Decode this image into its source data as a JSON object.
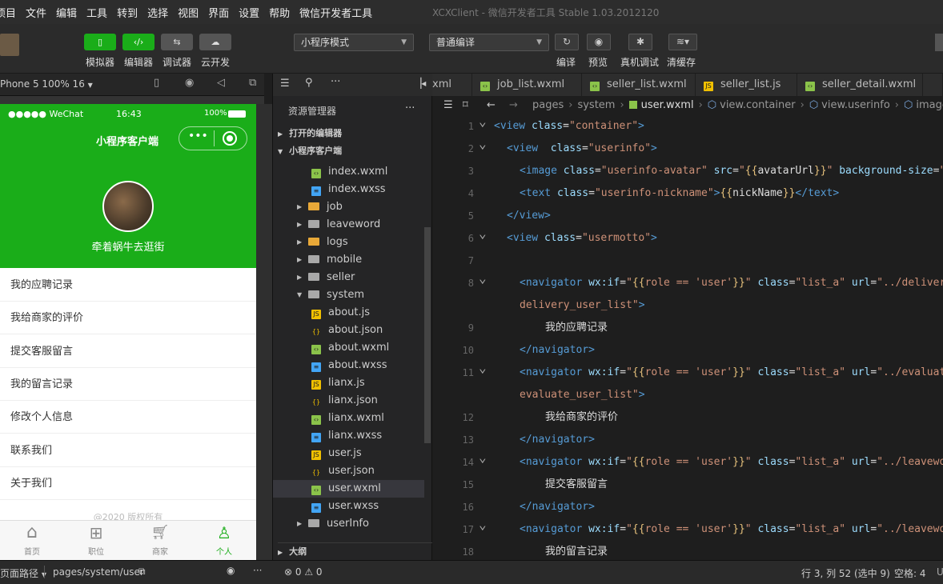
{
  "menubar": {
    "items": [
      "项目",
      "文件",
      "编辑",
      "工具",
      "转到",
      "选择",
      "视图",
      "界面",
      "设置",
      "帮助",
      "微信开发者工具"
    ],
    "title": "XCXClient - 微信开发者工具 Stable 1.03.2012120"
  },
  "toolbar": {
    "simulator": "模拟器",
    "editor": "编辑器",
    "debugger": "调试器",
    "cloud": "云开发",
    "mode": "小程序模式",
    "compile_mode": "普通编译",
    "compile": "编译",
    "preview": "预览",
    "device_debug": "真机调试",
    "clear_cache": "清缓存"
  },
  "simbar": {
    "device": "Phone 5 100% 16"
  },
  "phone": {
    "carrier": "●●●●● WeChat",
    "time": "16:43",
    "battery": "100%",
    "nav_title": "小程序客户端",
    "nickname": "牵着蜗牛去逛街",
    "menu": [
      "我的应聘记录",
      "我给商家的评价",
      "提交客服留言",
      "我的留言记录",
      "修改个人信息",
      "联系我们",
      "关于我们"
    ],
    "copyright": "@2020 版权所有",
    "tabs": [
      "首页",
      "职位",
      "商家",
      "个人"
    ]
  },
  "explorer": {
    "title": "资源管理器",
    "open_editors": "打开的编辑器",
    "project": "小程序客户端",
    "outline": "大纲",
    "files": [
      {
        "name": "index.wxml",
        "kind": "wxml",
        "indent": 2
      },
      {
        "name": "index.wxss",
        "kind": "wxss",
        "indent": 2
      },
      {
        "name": "job",
        "kind": "folder-y",
        "indent": 1
      },
      {
        "name": "leaveword",
        "kind": "folder",
        "indent": 1
      },
      {
        "name": "logs",
        "kind": "folder-y",
        "indent": 1
      },
      {
        "name": "mobile",
        "kind": "folder",
        "indent": 1
      },
      {
        "name": "seller",
        "kind": "folder",
        "indent": 1
      },
      {
        "name": "system",
        "kind": "folder-open",
        "indent": 1
      },
      {
        "name": "about.js",
        "kind": "js",
        "indent": 2
      },
      {
        "name": "about.json",
        "kind": "json",
        "indent": 2
      },
      {
        "name": "about.wxml",
        "kind": "wxml",
        "indent": 2
      },
      {
        "name": "about.wxss",
        "kind": "wxss",
        "indent": 2
      },
      {
        "name": "lianx.js",
        "kind": "js",
        "indent": 2
      },
      {
        "name": "lianx.json",
        "kind": "json",
        "indent": 2
      },
      {
        "name": "lianx.wxml",
        "kind": "wxml",
        "indent": 2
      },
      {
        "name": "lianx.wxss",
        "kind": "wxss",
        "indent": 2
      },
      {
        "name": "user.js",
        "kind": "js",
        "indent": 2
      },
      {
        "name": "user.json",
        "kind": "json",
        "indent": 2
      },
      {
        "name": "user.wxml",
        "kind": "wxml",
        "indent": 2,
        "selected": true
      },
      {
        "name": "user.wxss",
        "kind": "wxss",
        "indent": 2
      },
      {
        "name": "userInfo",
        "kind": "folder",
        "indent": 1
      }
    ]
  },
  "editor": {
    "tabs": [
      "xml",
      "job_list.wxml",
      "seller_list.wxml",
      "seller_list.js",
      "seller_detail.wxml"
    ],
    "breadcrumb": [
      "pages",
      "system",
      "user.wxml",
      "view.container",
      "view.userinfo",
      "image.use"
    ],
    "lines": [
      {
        "n": "1",
        "fold": true,
        "html": "<span class='tg'>&lt;view</span> <span class='at'>class</span><span class='pl'>=</span><span class='st'>\"container\"</span><span class='tg'>&gt;</span>",
        "ind": 0
      },
      {
        "n": "2",
        "fold": true,
        "html": "<span class='tg'>&lt;view</span>  <span class='at'>class</span><span class='pl'>=</span><span class='st'>\"userinfo\"</span><span class='tg'>&gt;</span>",
        "ind": 1
      },
      {
        "n": "3",
        "fold": false,
        "html": "<span class='tg'>&lt;image</span> <span class='at'>class</span><span class='pl'>=</span><span class='st'>\"userinfo-avatar\"</span> <span class='at'>src</span><span class='pl'>=</span><span class='st'>\"</span><span class='mu'>{{</span><span class='pl'>avatarUrl</span><span class='mu'>}}</span><span class='st'>\"</span> <span class='at'>background-size</span><span class='pl'>=</span><span class='st'>\"c</span>",
        "ind": 2
      },
      {
        "n": "4",
        "fold": false,
        "html": "<span class='tg'>&lt;text</span> <span class='at'>class</span><span class='pl'>=</span><span class='st'>\"userinfo-nickname\"</span><span class='tg'>&gt;</span><span class='mu'>{{</span><span class='pl'>nickName</span><span class='mu'>}}</span><span class='tg'>&lt;/text&gt;</span>",
        "ind": 2
      },
      {
        "n": "5",
        "fold": false,
        "html": "<span class='tg'>&lt;/view&gt;</span>",
        "ind": 1
      },
      {
        "n": "6",
        "fold": true,
        "html": "<span class='tg'>&lt;view</span> <span class='at'>class</span><span class='pl'>=</span><span class='st'>\"usermotto\"</span><span class='tg'>&gt;</span>",
        "ind": 1
      },
      {
        "n": "7",
        "fold": false,
        "html": "",
        "ind": 1
      },
      {
        "n": "8",
        "fold": true,
        "html": "<span class='tg'>&lt;navigator</span> <span class='at'>wx:if</span><span class='pl'>=</span><span class='st'>\"</span><span class='mu'>{{</span><span class='st'>role == 'user'</span><span class='mu'>}}</span><span class='st'>\"</span> <span class='at'>class</span><span class='pl'>=</span><span class='st'>\"list_a\"</span> <span class='at'>url</span><span class='pl'>=</span><span class='st'>\"../delivery</span>",
        "ind": 2
      },
      {
        "n": "",
        "fold": false,
        "html": "<span class='st'>delivery_user_list\"</span><span class='tg'>&gt;</span>",
        "ind": 2
      },
      {
        "n": "9",
        "fold": false,
        "html": "<span class='pl'>我的应聘记录</span>",
        "ind": 4
      },
      {
        "n": "10",
        "fold": false,
        "html": "<span class='tg'>&lt;/navigator&gt;</span>",
        "ind": 2
      },
      {
        "n": "11",
        "fold": true,
        "html": "<span class='tg'>&lt;navigator</span> <span class='at'>wx:if</span><span class='pl'>=</span><span class='st'>\"</span><span class='mu'>{{</span><span class='st'>role == 'user'</span><span class='mu'>}}</span><span class='st'>\"</span> <span class='at'>class</span><span class='pl'>=</span><span class='st'>\"list_a\"</span> <span class='at'>url</span><span class='pl'>=</span><span class='st'>\"../evaluate</span>",
        "ind": 2
      },
      {
        "n": "",
        "fold": false,
        "html": "<span class='st'>evaluate_user_list\"</span><span class='tg'>&gt;</span>",
        "ind": 2
      },
      {
        "n": "12",
        "fold": false,
        "html": "<span class='pl'>我给商家的评价</span>",
        "ind": 4
      },
      {
        "n": "13",
        "fold": false,
        "html": "<span class='tg'>&lt;/navigator&gt;</span>",
        "ind": 2
      },
      {
        "n": "14",
        "fold": true,
        "html": "<span class='tg'>&lt;navigator</span> <span class='at'>wx:if</span><span class='pl'>=</span><span class='st'>\"</span><span class='mu'>{{</span><span class='st'>role == 'user'</span><span class='mu'>}}</span><span class='st'>\"</span> <span class='at'>class</span><span class='pl'>=</span><span class='st'>\"list_a\"</span> <span class='at'>url</span><span class='pl'>=</span><span class='st'>\"../leavewor</span>",
        "ind": 2
      },
      {
        "n": "15",
        "fold": false,
        "html": "<span class='pl'>提交客服留言</span>",
        "ind": 4
      },
      {
        "n": "16",
        "fold": false,
        "html": "<span class='tg'>&lt;/navigator&gt;</span>",
        "ind": 2
      },
      {
        "n": "17",
        "fold": true,
        "html": "<span class='tg'>&lt;navigator</span> <span class='at'>wx:if</span><span class='pl'>=</span><span class='st'>\"</span><span class='mu'>{{</span><span class='st'>role == 'user'</span><span class='mu'>}}</span><span class='st'>\"</span> <span class='at'>class</span><span class='pl'>=</span><span class='st'>\"list_a\"</span> <span class='at'>url</span><span class='pl'>=</span><span class='st'>\"../leavewor</span>",
        "ind": 2
      },
      {
        "n": "18",
        "fold": false,
        "html": "<span class='pl'>我的留言记录</span>",
        "ind": 4
      }
    ]
  },
  "statusbar": {
    "page_path_label": "页面路径",
    "page_path": "pages/system/user",
    "problems": "⊗ 0 ⚠ 0",
    "position": "行 3, 列 52 (选中 9)",
    "spaces": "空格: 4"
  }
}
